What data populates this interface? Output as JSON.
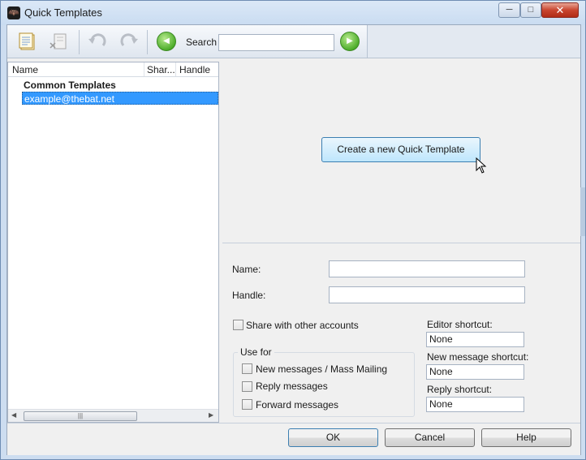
{
  "window": {
    "title": "Quick Templates",
    "min_label": "─",
    "max_label": "□",
    "close_label": "✕"
  },
  "toolbar": {
    "search_label": "Search",
    "search_value": "",
    "back_icon": "◀",
    "forward_icon": "▶"
  },
  "tree": {
    "columns": [
      "Name",
      "Shar...",
      "Handle"
    ],
    "items": [
      {
        "label": "Common Templates"
      },
      {
        "label": "example@thebat.net"
      }
    ],
    "scroll_grip": "|||",
    "scroll_left": "◀",
    "scroll_right": "▶"
  },
  "main": {
    "create_button": "Create a new Quick Template"
  },
  "form": {
    "name_label": "Name:",
    "name_value": "",
    "handle_label": "Handle:",
    "handle_value": "",
    "share_label": "Share with other accounts",
    "use_for_title": "Use for",
    "use_for_options": [
      "New messages / Mass Mailing",
      "Reply messages",
      "Forward messages"
    ],
    "editor_shortcut_label": "Editor shortcut:",
    "editor_shortcut_value": "None",
    "new_message_shortcut_label": "New message shortcut:",
    "new_message_shortcut_value": "None",
    "reply_shortcut_label": "Reply shortcut:",
    "reply_shortcut_value": "None"
  },
  "buttons": {
    "ok": "OK",
    "cancel": "Cancel",
    "help": "Help"
  }
}
